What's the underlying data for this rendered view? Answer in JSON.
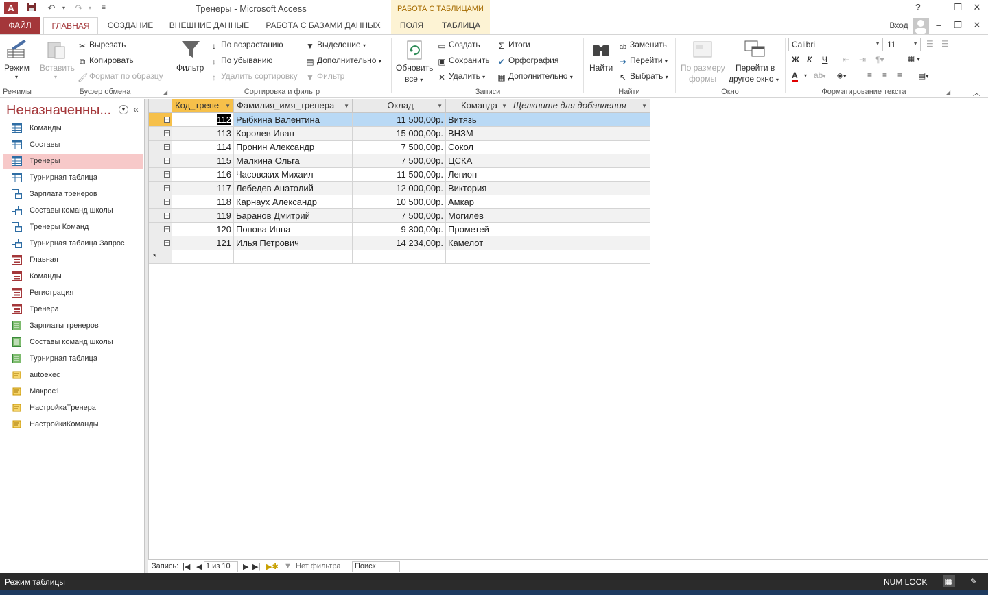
{
  "window": {
    "title": "Тренеры - Microsoft Access",
    "context_group": "РАБОТА С ТАБЛИЦАМИ",
    "help": "?",
    "login": "Вход"
  },
  "tabs": {
    "file": "ФАЙЛ",
    "items": [
      "ГЛАВНАЯ",
      "СОЗДАНИЕ",
      "ВНЕШНИЕ ДАННЫЕ",
      "РАБОТА С БАЗАМИ ДАННЫХ",
      "ПОЛЯ",
      "ТАБЛИЦА"
    ],
    "active": "ГЛАВНАЯ"
  },
  "ribbon": {
    "views": {
      "mode": "Режим",
      "label": "Режимы"
    },
    "clipboard": {
      "paste": "Вставить",
      "cut": "Вырезать",
      "copy": "Копировать",
      "format_painter": "Формат по образцу",
      "label": "Буфер обмена"
    },
    "sort_filter": {
      "filter": "Фильтр",
      "asc": "По возрастанию",
      "desc": "По убыванию",
      "remove_sort": "Удалить сортировку",
      "selection": "Выделение",
      "advanced": "Дополнительно",
      "toggle_filter": "Фильтр",
      "label": "Сортировка и фильтр"
    },
    "records": {
      "refresh": "Обновить",
      "refresh2": "все",
      "new": "Создать",
      "save": "Сохранить",
      "delete": "Удалить",
      "totals": "Итоги",
      "spelling": "Орфография",
      "more": "Дополнительно",
      "label": "Записи"
    },
    "find": {
      "find": "Найти",
      "replace": "Заменить",
      "goto": "Перейти",
      "select": "Выбрать",
      "label": "Найти"
    },
    "window": {
      "size_to_fit": "По размеру",
      "size_to_fit2": "формы",
      "switch": "Перейти в",
      "switch2": "другое окно",
      "label": "Окно"
    },
    "text_format": {
      "font": "Calibri",
      "size": "11",
      "bold": "Ж",
      "italic": "К",
      "underline": "Ч",
      "label": "Форматирование текста"
    }
  },
  "nav": {
    "title": "Неназначенны...",
    "items": [
      {
        "label": "Команды",
        "type": "table"
      },
      {
        "label": "Составы",
        "type": "table"
      },
      {
        "label": "Тренеры",
        "type": "table"
      },
      {
        "label": "Турнирная таблица",
        "type": "table"
      },
      {
        "label": "Зарплата тренеров",
        "type": "query"
      },
      {
        "label": "Составы команд школы",
        "type": "query"
      },
      {
        "label": "Тренеры Команд",
        "type": "query"
      },
      {
        "label": "Турнирная таблица Запрос",
        "type": "query"
      },
      {
        "label": "Главная",
        "type": "form"
      },
      {
        "label": "Команды",
        "type": "form"
      },
      {
        "label": "Регистрация",
        "type": "form"
      },
      {
        "label": "Тренера",
        "type": "form"
      },
      {
        "label": "Зарплаты тренеров",
        "type": "report"
      },
      {
        "label": "Составы команд школы",
        "type": "report"
      },
      {
        "label": "Турнирная таблица",
        "type": "report"
      },
      {
        "label": "autoexec",
        "type": "macro"
      },
      {
        "label": "Макрос1",
        "type": "macro"
      },
      {
        "label": "НастройкаТренера",
        "type": "macro"
      },
      {
        "label": "НастройкиКоманды",
        "type": "macro"
      }
    ],
    "selected_index": 2
  },
  "table": {
    "columns": [
      "Код_трене",
      "Фамилия_имя_тренера",
      "Оклад",
      "Команда",
      "Щелкните для добавления"
    ],
    "rows": [
      [
        "112",
        "Рыбкина Валентина",
        "11 500,00р.",
        "Витязь"
      ],
      [
        "113",
        "Королев Иван",
        "15 000,00р.",
        "ВНЗМ"
      ],
      [
        "114",
        "Пронин Александр",
        "7 500,00р.",
        "Сокол"
      ],
      [
        "115",
        "Малкина Ольга",
        "7 500,00р.",
        "ЦСКА"
      ],
      [
        "116",
        "Часовских Михаил",
        "11 500,00р.",
        "Легион"
      ],
      [
        "117",
        "Лебедев Анатолий",
        "12 000,00р.",
        "Виктория"
      ],
      [
        "118",
        "Карнаух Александр",
        "10 500,00р.",
        "Амкар"
      ],
      [
        "119",
        "Баранов Дмитрий",
        "7 500,00р.",
        "Могилёв"
      ],
      [
        "120",
        "Попова Инна",
        "9 300,00р.",
        "Прометей"
      ],
      [
        "121",
        "Илья Петрович",
        "14 234,00р.",
        "Камелот"
      ]
    ],
    "new_row_marker": "*"
  },
  "record_nav": {
    "label": "Запись:",
    "position": "1 из 10",
    "filter": "Нет фильтра",
    "search_placeholder": "Поиск"
  },
  "status": {
    "mode": "Режим таблицы",
    "numlock": "NUM LOCK"
  },
  "colors": {
    "accent": "#a4373a",
    "selected_row": "#b9d9f5",
    "nav_selected": "#f7c9c9",
    "context_tab": "#fdf3d4"
  }
}
